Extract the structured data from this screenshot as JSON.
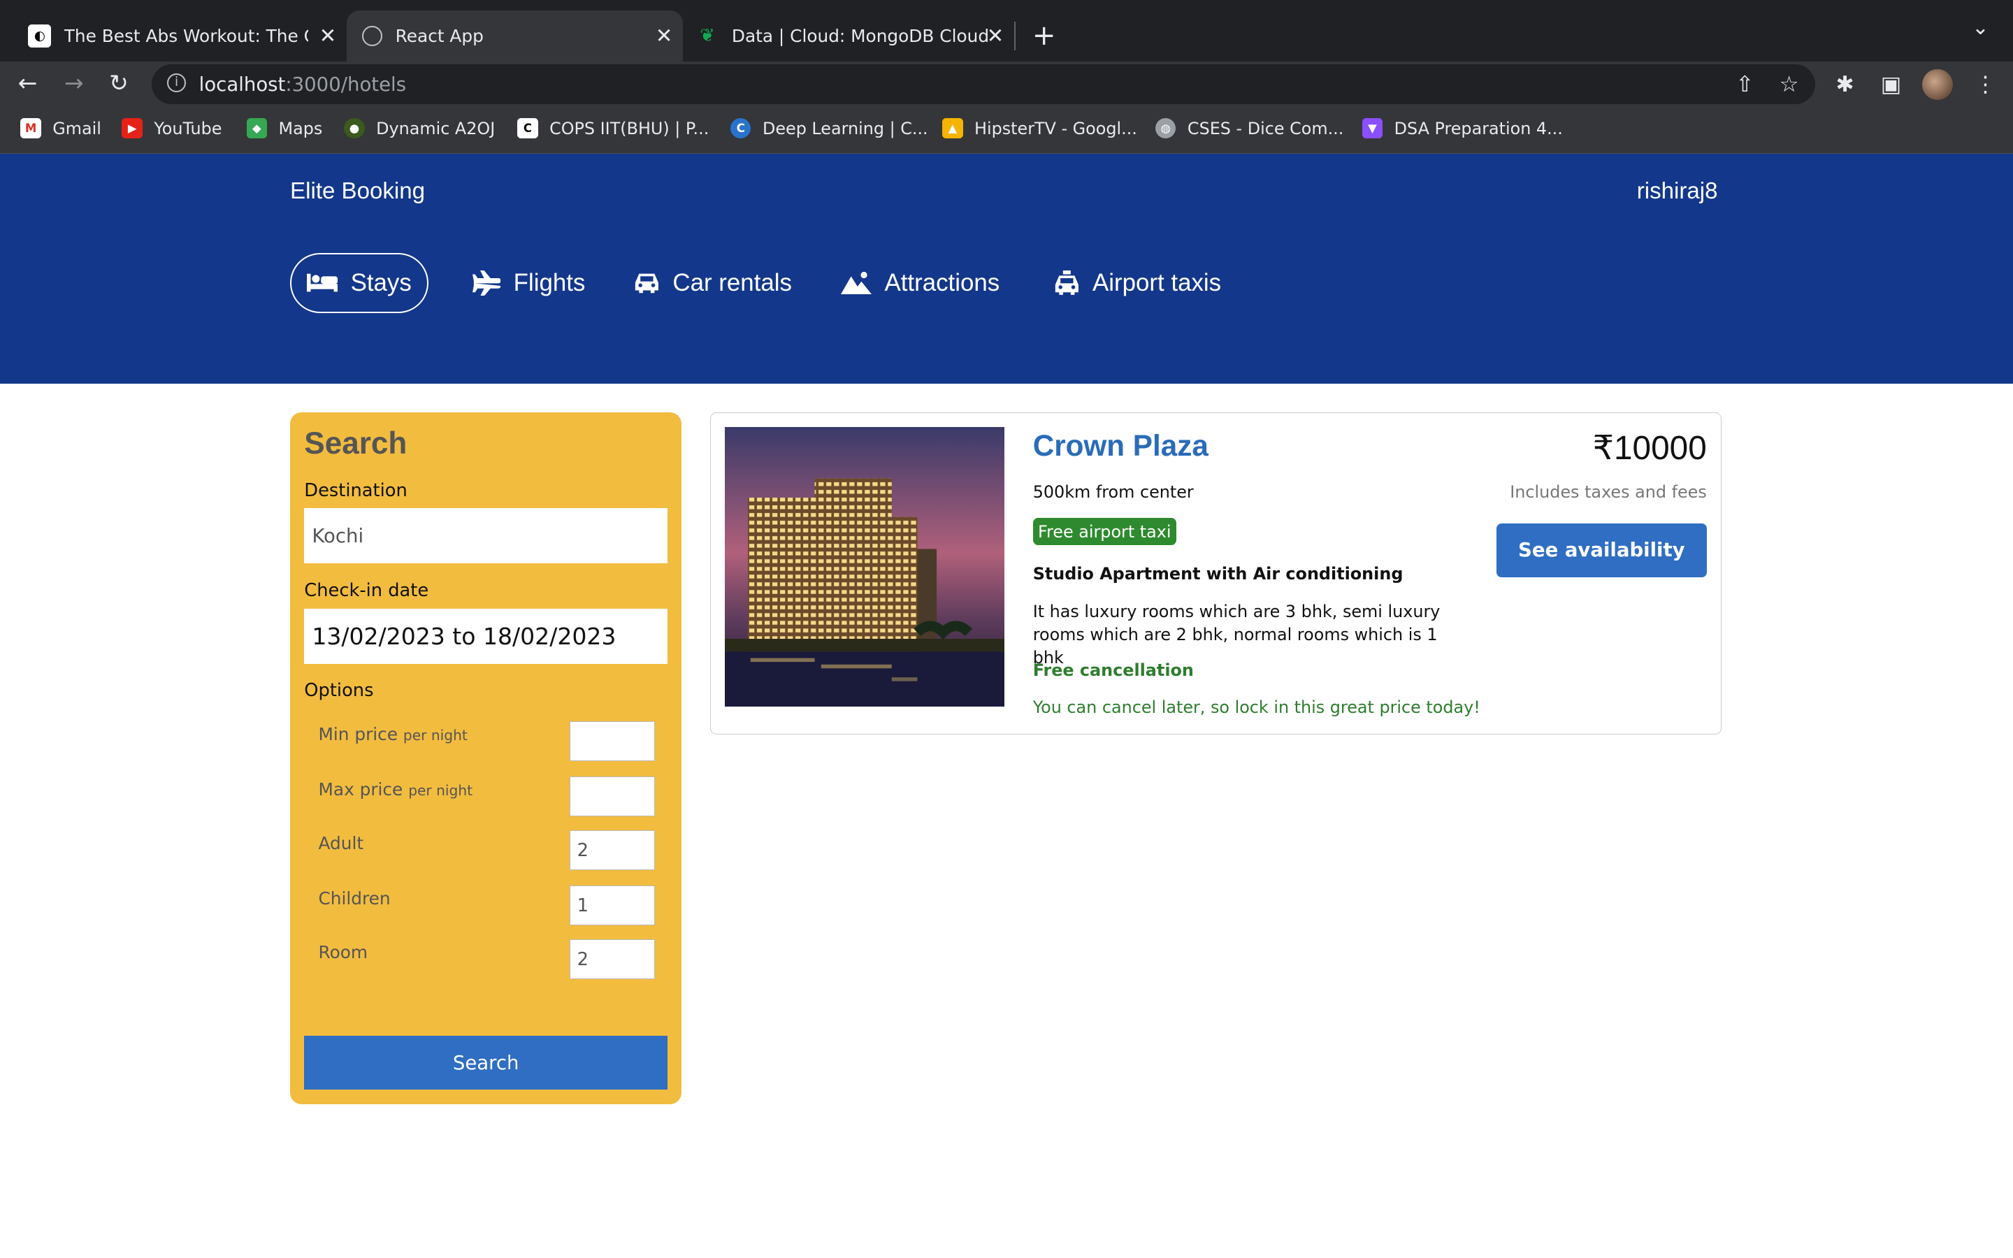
{
  "browser": {
    "tabs": [
      {
        "title": "The Best Abs Workout: The On",
        "active": false
      },
      {
        "title": "React App",
        "active": true
      },
      {
        "title": "Data | Cloud: MongoDB Cloud",
        "active": false
      }
    ],
    "url_host": "localhost",
    "url_rest": ":3000/hotels",
    "bookmarks": [
      "Gmail",
      "YouTube",
      "Maps",
      "Dynamic A2OJ",
      "COPS IIT(BHU) | P...",
      "Deep Learning | C...",
      "HipsterTV - Googl...",
      "CSES - Dice Com...",
      "DSA Preparation 4..."
    ]
  },
  "header": {
    "brand": "Elite Booking",
    "username": "rishiraj8",
    "nav": [
      "Stays",
      "Flights",
      "Car rentals",
      "Attractions",
      "Airport taxis"
    ],
    "color": "#13378a"
  },
  "search": {
    "title": "Search",
    "destination_label": "Destination",
    "destination_value": "Kochi",
    "checkin_label": "Check-in date",
    "checkin_value": "13/02/2023 to 18/02/2023",
    "options_label": "Options",
    "per_night": "per night",
    "options": [
      {
        "label": "Min price",
        "value": ""
      },
      {
        "label": "Max price",
        "value": ""
      },
      {
        "label": "Adult",
        "value": "2"
      },
      {
        "label": "Children",
        "value": "1"
      },
      {
        "label": "Room",
        "value": "2"
      }
    ],
    "button": "Search",
    "panel_color": "#f2bc3f"
  },
  "result": {
    "name": "Crown Plaza",
    "distance": "500km from center",
    "taxi_badge": "Free airport taxi",
    "subtitle": "Studio Apartment with Air conditioning",
    "description": "It has luxury rooms which are 3 bhk, semi luxury rooms which are 2 bhk, normal rooms which is 1 bhk",
    "cancel": "Free cancellation",
    "cancel_sub": "You can cancel later, so lock in this great price today!",
    "price": "₹10000",
    "taxes": "Includes taxes and fees",
    "button": "See availability"
  }
}
